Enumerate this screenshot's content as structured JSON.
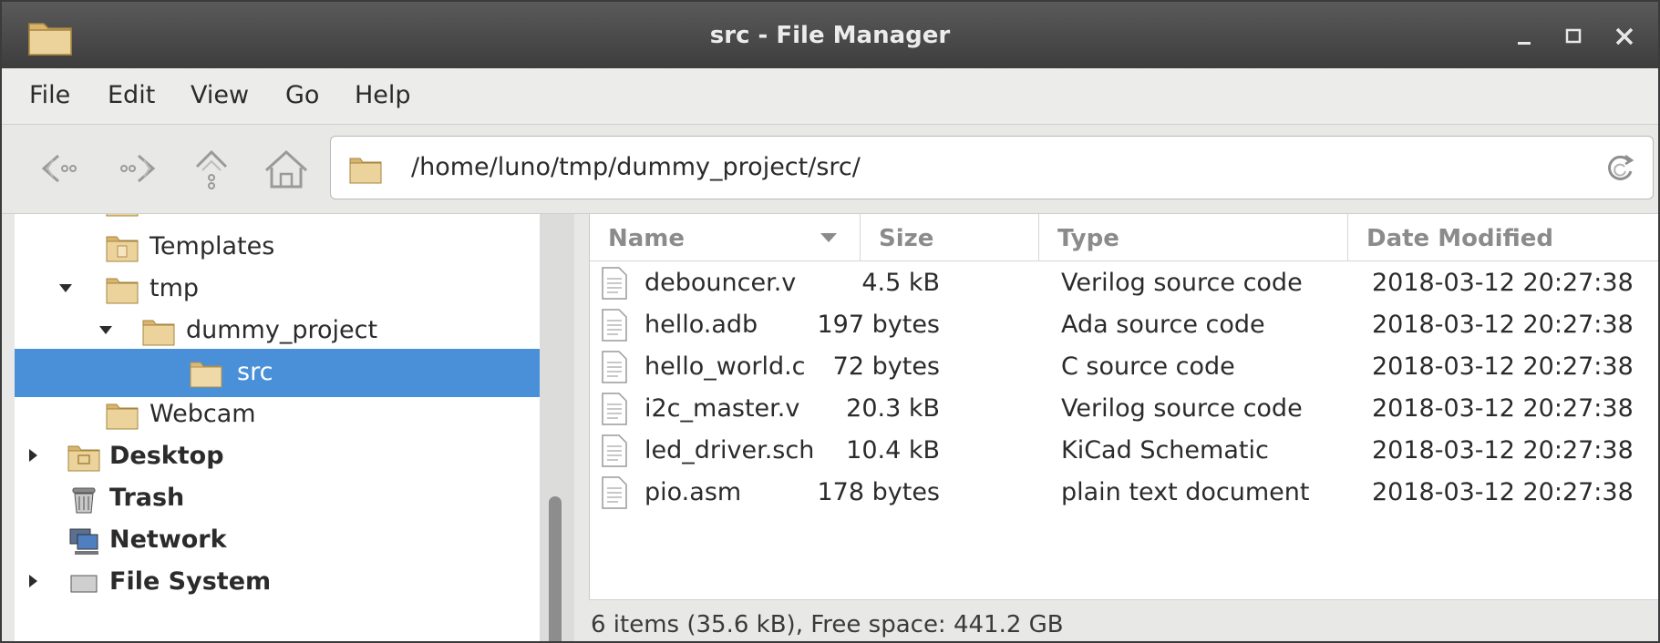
{
  "window": {
    "title": "src - File Manager",
    "controls": [
      "minimize",
      "maximize",
      "close"
    ]
  },
  "menu": {
    "items": [
      "File",
      "Edit",
      "View",
      "Go",
      "Help"
    ]
  },
  "toolbar": {
    "path": "/home/luno/tmp/dummy_project/src/"
  },
  "sidebar": {
    "items": [
      {
        "label": "Templates",
        "bold": false,
        "icon": "templates-folder-icon"
      },
      {
        "label": "tmp",
        "bold": false,
        "icon": "folder-icon",
        "expanded": true
      },
      {
        "label": "dummy_project",
        "bold": false,
        "icon": "folder-icon",
        "expanded": true
      },
      {
        "label": "src",
        "bold": false,
        "icon": "folder-icon",
        "selected": true
      },
      {
        "label": "Webcam",
        "bold": false,
        "icon": "folder-icon"
      },
      {
        "label": "Desktop",
        "bold": true,
        "icon": "desktop-folder-icon",
        "expandable": true
      },
      {
        "label": "Trash",
        "bold": true,
        "icon": "trash-icon"
      },
      {
        "label": "Network",
        "bold": true,
        "icon": "network-icon"
      },
      {
        "label": "File System",
        "bold": true,
        "icon": "drive-icon",
        "expandable": true
      }
    ]
  },
  "columns": {
    "name": "Name",
    "size": "Size",
    "type": "Type",
    "modified": "Date Modified"
  },
  "files": [
    {
      "name": "debouncer.v",
      "size": "4.5 kB",
      "type": "Verilog source code",
      "modified": "2018-03-12 20:27:38"
    },
    {
      "name": "hello.adb",
      "size": "197 bytes",
      "type": "Ada source code",
      "modified": "2018-03-12 20:27:38"
    },
    {
      "name": "hello_world.c",
      "size": "72 bytes",
      "type": "C source code",
      "modified": "2018-03-12 20:27:38"
    },
    {
      "name": "i2c_master.v",
      "size": "20.3 kB",
      "type": "Verilog source code",
      "modified": "2018-03-12 20:27:38"
    },
    {
      "name": "led_driver.sch",
      "size": "10.4 kB",
      "type": "KiCad Schematic",
      "modified": "2018-03-12 20:27:38"
    },
    {
      "name": "pio.asm",
      "size": "178 bytes",
      "type": "plain text document",
      "modified": "2018-03-12 20:27:38"
    }
  ],
  "status": {
    "text": "6 items (35.6 kB), Free space: 441.2 GB"
  },
  "colors": {
    "selection": "#4a90d9",
    "titlebar": "#4a4a4a",
    "folder": "#e9c98b"
  }
}
